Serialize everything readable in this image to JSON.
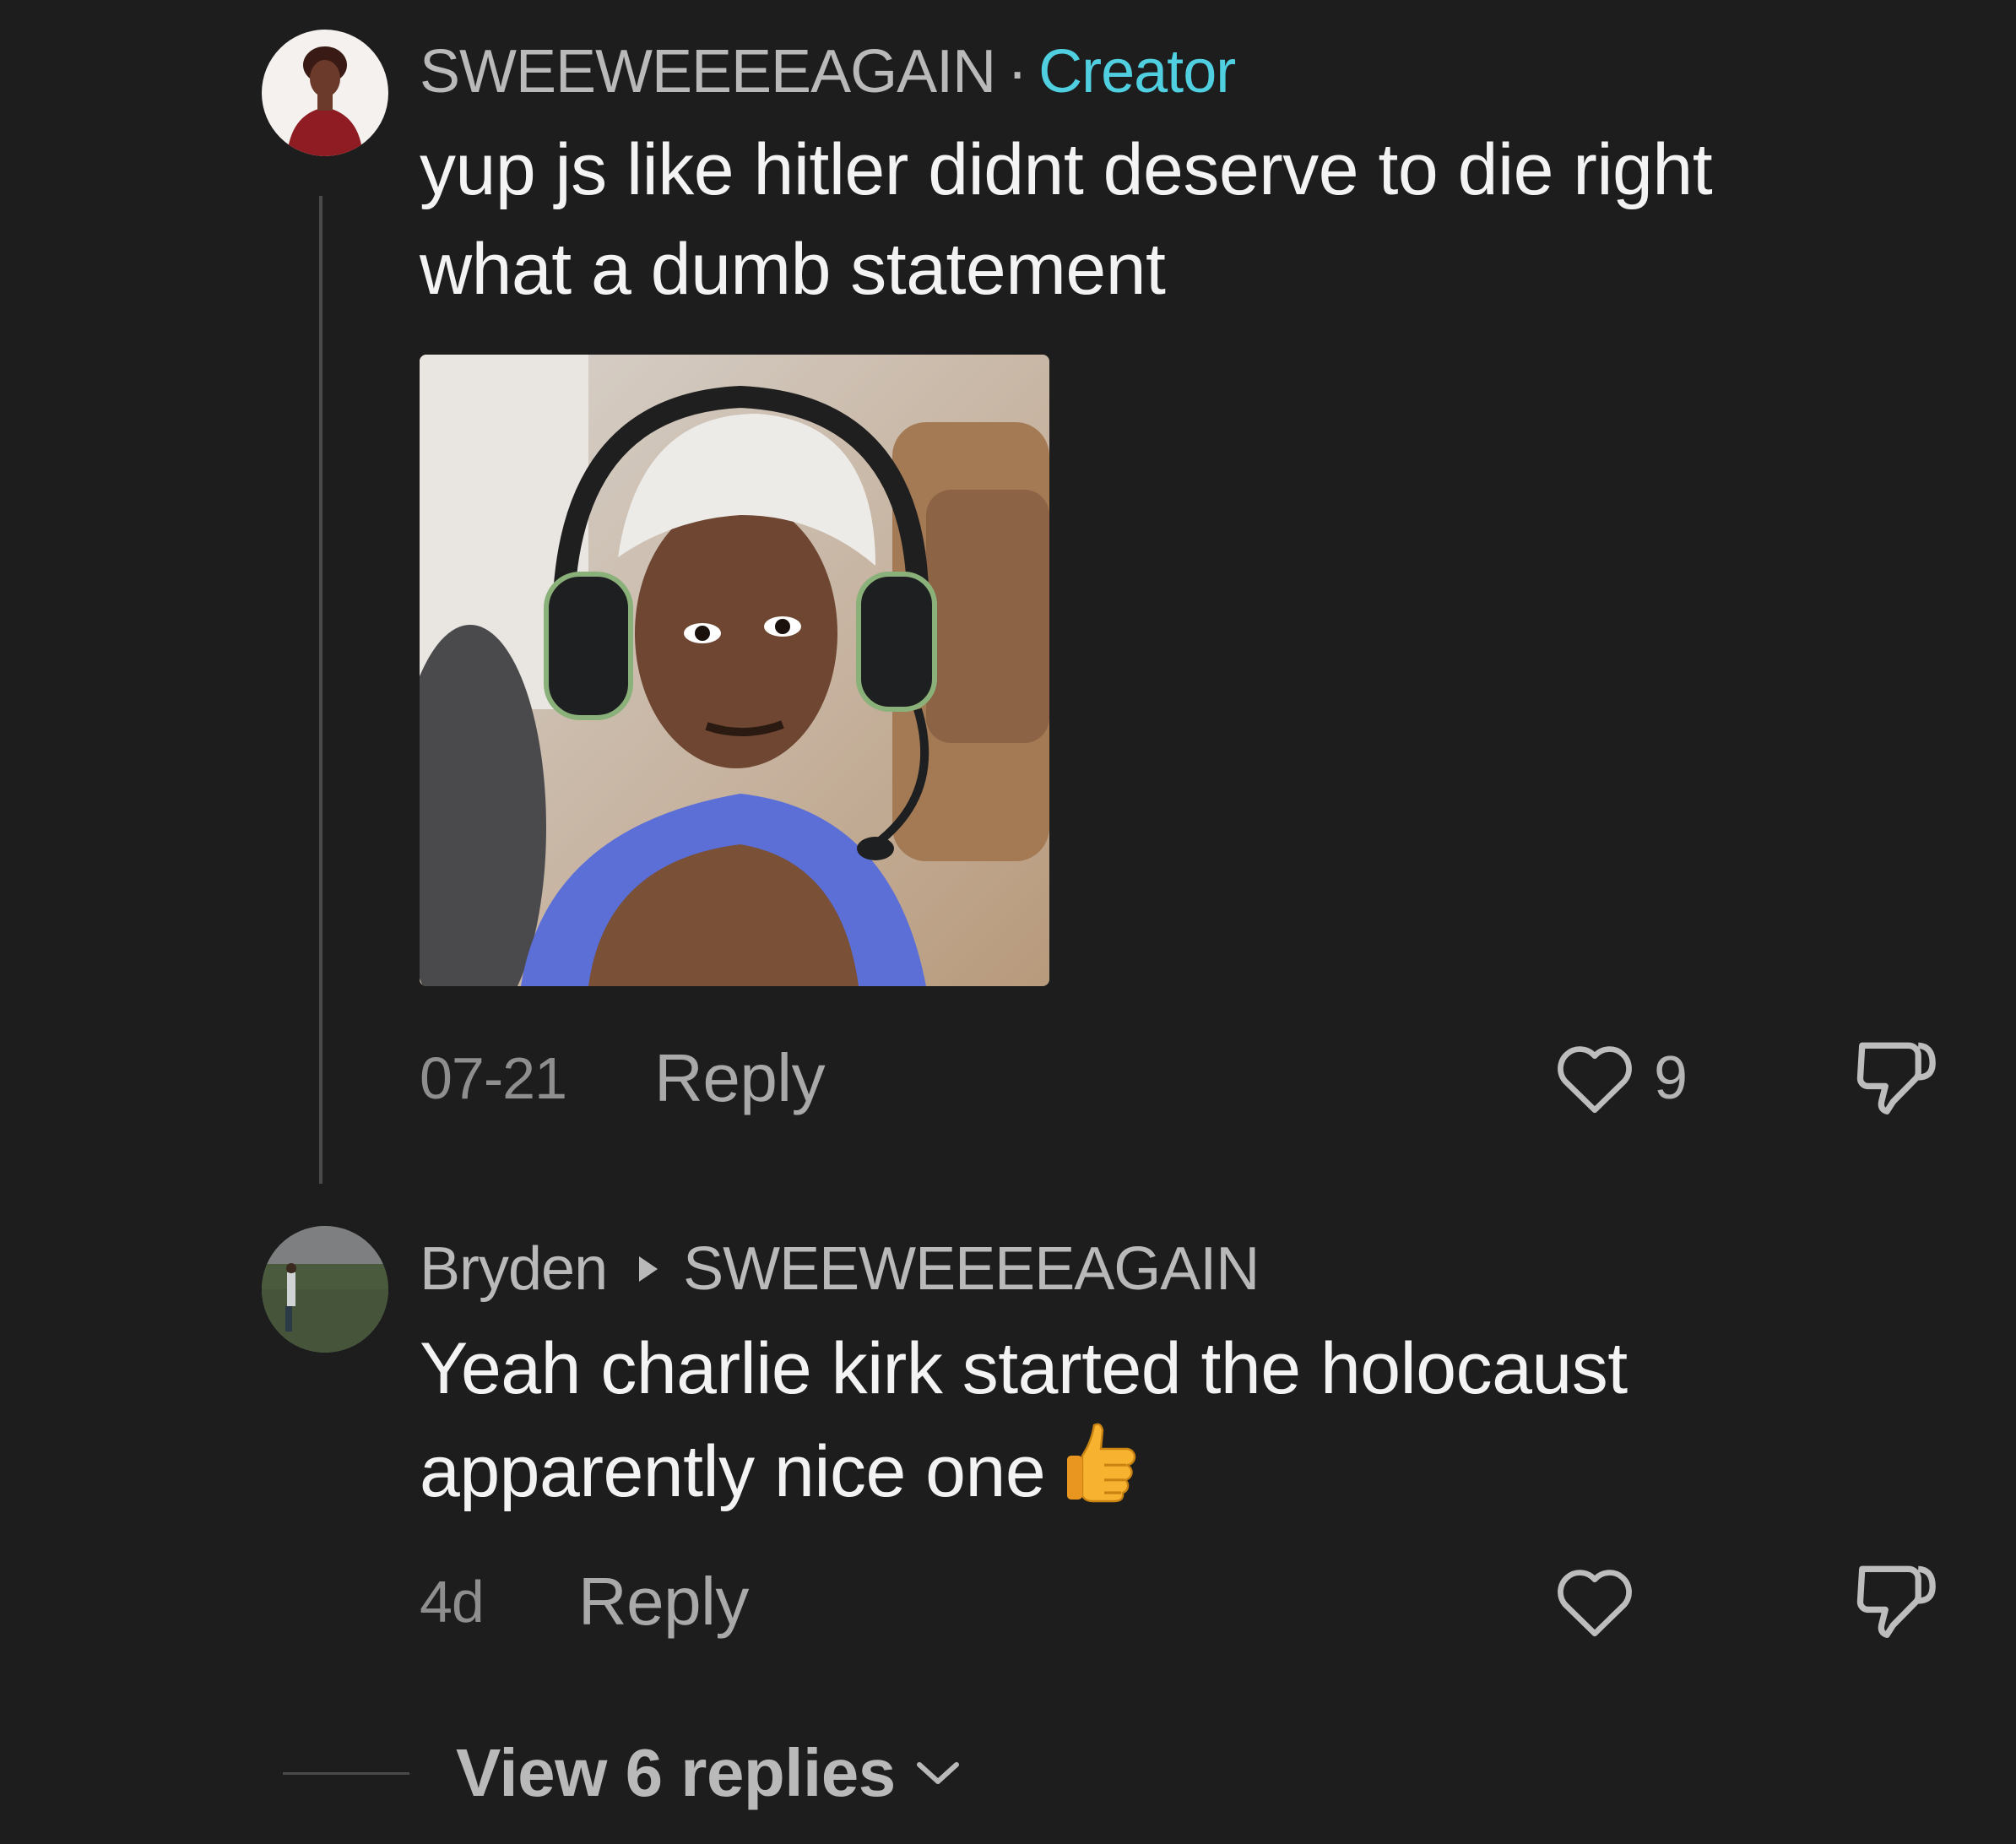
{
  "comments": [
    {
      "author": "SWEEWEEEEAGAIN",
      "separator": "·",
      "badge": "Creator",
      "text_line1": "yup js like hitler didnt deserve to die right",
      "text_line2": "what a dumb statement",
      "has_sticker": true,
      "timestamp": "07-21",
      "reply_label": "Reply",
      "like_count": "9"
    },
    {
      "author": "Bryden",
      "reply_to": "SWEEWEEEEAGAIN",
      "text_line1": "Yeah charlie kirk started the holocaust",
      "text_line2": "apparently nice one",
      "emoji": "thumbs-up",
      "timestamp": "4d",
      "reply_label": "Reply",
      "like_count": ""
    }
  ],
  "view_replies": {
    "label": "View 6 replies"
  },
  "icons": {
    "like": "heart-outline-icon",
    "dislike": "thumbs-down-outline-icon",
    "expand": "chevron-down-icon"
  },
  "colors": {
    "background": "#1d1d1e",
    "creator_badge": "#4fcfe0",
    "secondary_text": "#8e8e8f",
    "primary_text": "#f3f3f3"
  }
}
